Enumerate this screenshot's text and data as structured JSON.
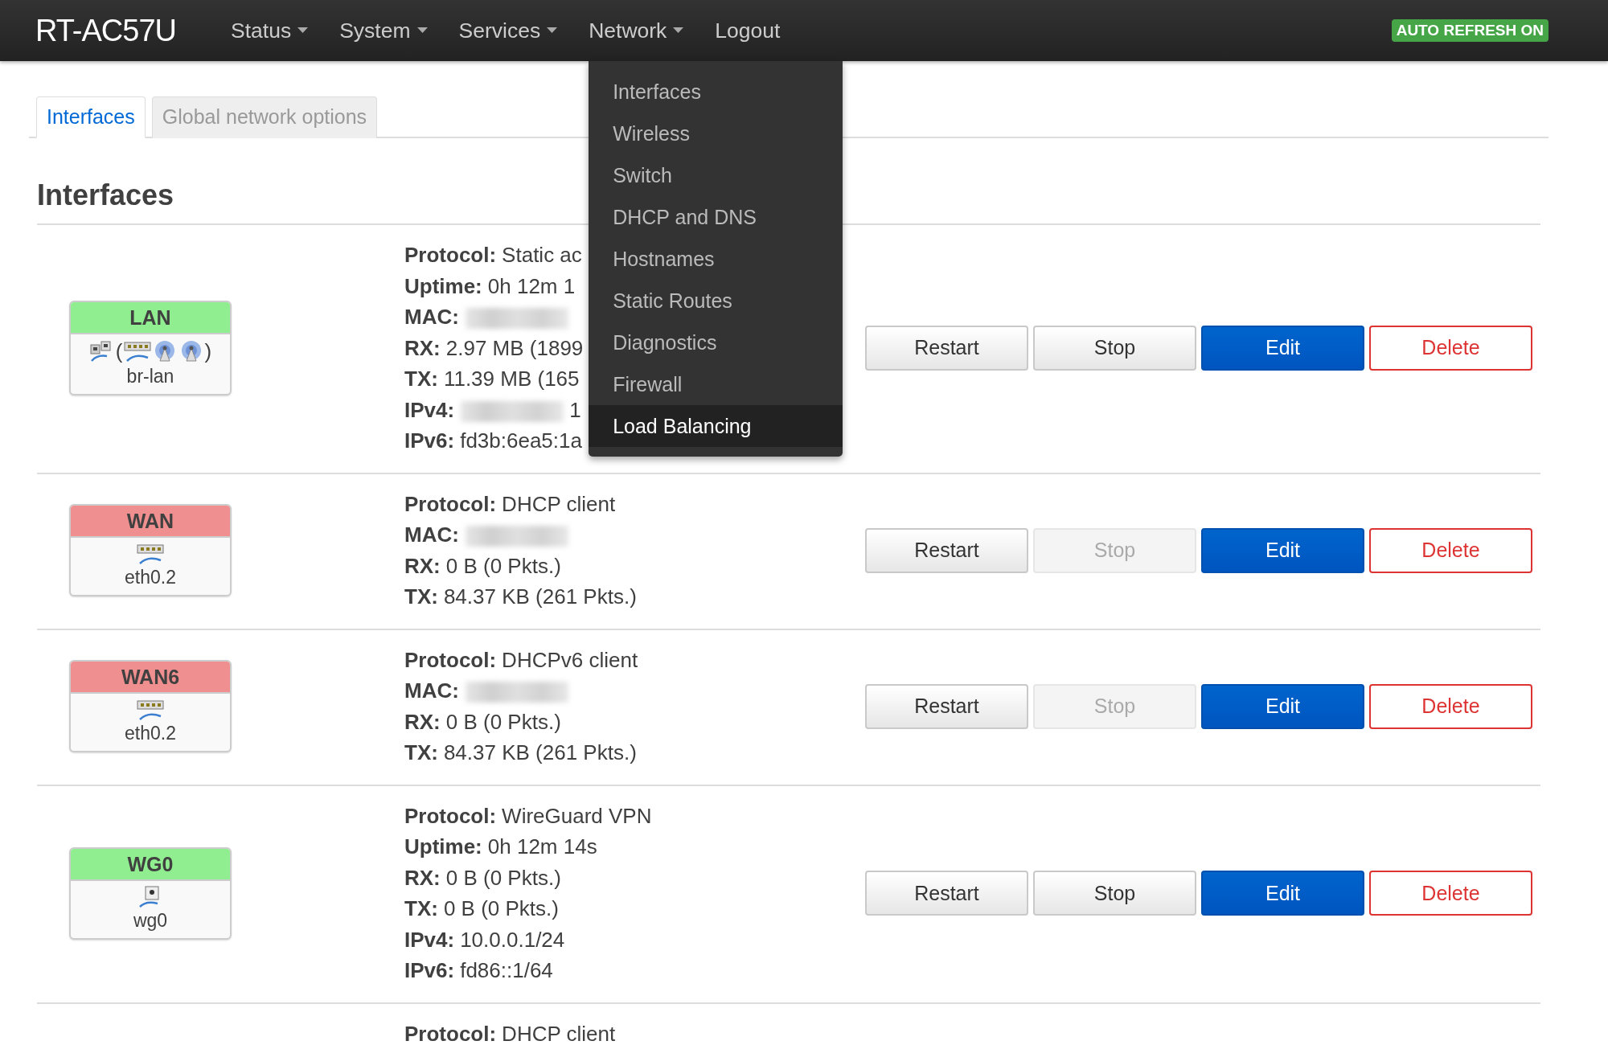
{
  "brand": "RT-AC57U",
  "nav": [
    {
      "label": "Status",
      "has_menu": true,
      "expanded": false
    },
    {
      "label": "System",
      "has_menu": true,
      "expanded": false
    },
    {
      "label": "Services",
      "has_menu": true,
      "expanded": false
    },
    {
      "label": "Network",
      "has_menu": true,
      "expanded": true
    },
    {
      "label": "Logout",
      "has_menu": false,
      "expanded": false
    }
  ],
  "auto_refresh": "AUTO REFRESH ON",
  "dropdown": [
    {
      "label": "Interfaces",
      "selected": false
    },
    {
      "label": "Wireless",
      "selected": false
    },
    {
      "label": "Switch",
      "selected": false
    },
    {
      "label": "DHCP and DNS",
      "selected": false
    },
    {
      "label": "Hostnames",
      "selected": false
    },
    {
      "label": "Static Routes",
      "selected": false
    },
    {
      "label": "Diagnostics",
      "selected": false
    },
    {
      "label": "Firewall",
      "selected": false
    },
    {
      "label": "Load Balancing",
      "selected": true
    }
  ],
  "tabs": [
    {
      "label": "Interfaces",
      "selected": true
    },
    {
      "label": "Global network options",
      "selected": false
    }
  ],
  "heading": "Interfaces",
  "rows": [
    {
      "iface": {
        "name": "LAN",
        "color": "#90ee90",
        "device": "br-lan",
        "icons": [
          {
            "kind": "bridge"
          },
          {
            "kind": "paren",
            "text": "("
          },
          {
            "kind": "switch"
          },
          {
            "kind": "wifi"
          },
          {
            "kind": "wifi"
          },
          {
            "kind": "paren",
            "text": ")"
          }
        ]
      },
      "fields": [
        {
          "label": "Protocol:",
          "value": "Static ac",
          "blurred": false
        },
        {
          "label": "Uptime:",
          "value": "0h 12m 1",
          "blurred": false
        },
        {
          "label": "MAC:",
          "blurred": true
        },
        {
          "label": "RX:",
          "value": "2.97 MB (1899",
          "blurred": false
        },
        {
          "label": "TX:",
          "value": "11.39 MB (165",
          "blurred": false
        },
        {
          "label": "IPv4:",
          "value": "1",
          "blurred": true
        },
        {
          "label": "IPv6:",
          "value": "fd3b:6ea5:1a",
          "blurred": false
        }
      ],
      "buttons": [
        {
          "label": "Restart",
          "kind": "default",
          "disabled": false
        },
        {
          "label": "Stop",
          "kind": "default",
          "disabled": false
        },
        {
          "label": "Edit",
          "kind": "primary",
          "disabled": false
        },
        {
          "label": "Delete",
          "kind": "danger",
          "disabled": false
        }
      ]
    },
    {
      "iface": {
        "name": "WAN",
        "color": "#f08f8f",
        "device": "eth0.2",
        "icons": [
          {
            "kind": "switch"
          }
        ]
      },
      "fields": [
        {
          "label": "Protocol:",
          "value": "DHCP client",
          "blurred": false
        },
        {
          "label": "MAC:",
          "blurred": true
        },
        {
          "label": "RX:",
          "value": "0 B (0 Pkts.)",
          "blurred": false
        },
        {
          "label": "TX:",
          "value": "84.37 KB (261 Pkts.)",
          "blurred": false
        }
      ],
      "buttons": [
        {
          "label": "Restart",
          "kind": "default",
          "disabled": false
        },
        {
          "label": "Stop",
          "kind": "default",
          "disabled": true
        },
        {
          "label": "Edit",
          "kind": "primary",
          "disabled": false
        },
        {
          "label": "Delete",
          "kind": "danger",
          "disabled": false
        }
      ]
    },
    {
      "iface": {
        "name": "WAN6",
        "color": "#f08f8f",
        "device": "eth0.2",
        "icons": [
          {
            "kind": "switch"
          }
        ]
      },
      "fields": [
        {
          "label": "Protocol:",
          "value": "DHCPv6 client",
          "blurred": false
        },
        {
          "label": "MAC:",
          "blurred": true
        },
        {
          "label": "RX:",
          "value": "0 B (0 Pkts.)",
          "blurred": false
        },
        {
          "label": "TX:",
          "value": "84.37 KB (261 Pkts.)",
          "blurred": false
        }
      ],
      "buttons": [
        {
          "label": "Restart",
          "kind": "default",
          "disabled": false
        },
        {
          "label": "Stop",
          "kind": "default",
          "disabled": true
        },
        {
          "label": "Edit",
          "kind": "primary",
          "disabled": false
        },
        {
          "label": "Delete",
          "kind": "danger",
          "disabled": false
        }
      ]
    },
    {
      "iface": {
        "name": "WG0",
        "color": "#90ee90",
        "device": "wg0",
        "icons": [
          {
            "kind": "tunnel"
          }
        ]
      },
      "fields": [
        {
          "label": "Protocol:",
          "value": "WireGuard VPN",
          "blurred": false
        },
        {
          "label": "Uptime:",
          "value": "0h 12m 14s",
          "blurred": false
        },
        {
          "label": "RX:",
          "value": "0 B (0 Pkts.)",
          "blurred": false
        },
        {
          "label": "TX:",
          "value": "0 B (0 Pkts.)",
          "blurred": false
        },
        {
          "label": "IPv4:",
          "value": "10.0.0.1/24",
          "blurred": false
        },
        {
          "label": "IPv6:",
          "value": "fd86::1/64",
          "blurred": false
        }
      ],
      "buttons": [
        {
          "label": "Restart",
          "kind": "default",
          "disabled": false
        },
        {
          "label": "Stop",
          "kind": "default",
          "disabled": false
        },
        {
          "label": "Edit",
          "kind": "primary",
          "disabled": false
        },
        {
          "label": "Delete",
          "kind": "danger",
          "disabled": false
        }
      ]
    },
    {
      "fields": [
        {
          "label": "Protocol:",
          "value": "DHCP client",
          "blurred": false
        }
      ]
    }
  ]
}
